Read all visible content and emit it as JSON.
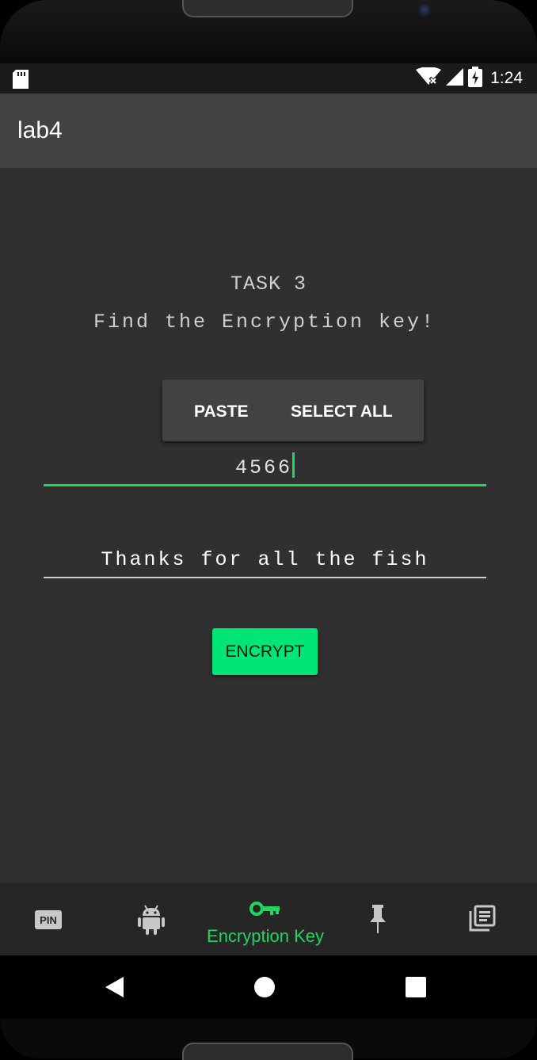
{
  "status_bar": {
    "time": "1:24"
  },
  "app_bar": {
    "title": "lab4"
  },
  "task": {
    "title": "TASK 3",
    "subtitle": "Find the Encryption key!"
  },
  "context_menu": {
    "paste": "PASTE",
    "select_all": "SELECT ALL"
  },
  "key_field": {
    "value": "4566"
  },
  "message_field": {
    "value": "Thanks for all the fish"
  },
  "encrypt_button": {
    "label": "ENCRYPT"
  },
  "bottom_nav": {
    "items": [
      {
        "icon": "pin-icon"
      },
      {
        "icon": "android-icon"
      },
      {
        "icon": "key-icon",
        "label": "Encryption Key",
        "active": true
      },
      {
        "icon": "pushpin-icon"
      },
      {
        "icon": "library-books-icon"
      }
    ]
  },
  "colors": {
    "accent": "#00e676",
    "background": "#303030",
    "app_bar": "#424242",
    "bottom_nav": "#262626"
  }
}
